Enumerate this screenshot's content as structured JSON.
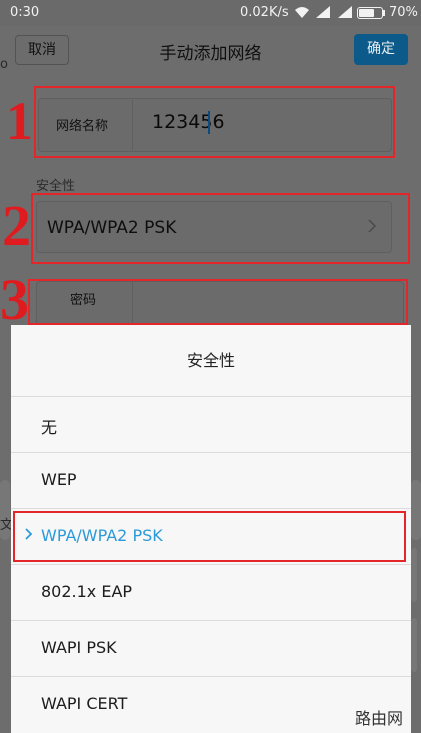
{
  "status_bar": {
    "time": "0:30",
    "speed": "0.02K/s",
    "battery": "70%",
    "battery_level": 0.7
  },
  "header": {
    "cancel": "取消",
    "title": "手动添加网络",
    "confirm": "确定"
  },
  "form": {
    "name_label": "网络名称",
    "name_value": "123456",
    "security_heading": "安全性",
    "security_value": "WPA/WPA2 PSK",
    "password_label": "密码"
  },
  "annotations": [
    "1",
    "2",
    "3"
  ],
  "sheet": {
    "title": "安全性",
    "options": [
      "无",
      "WEP",
      "WPA/WPA2 PSK",
      "802.1x EAP",
      "WAPI PSK",
      "WAPI CERT"
    ],
    "selected_index": 2
  },
  "background_fragments": [
    "o",
    "文"
  ],
  "watermark": "路由网",
  "colors": {
    "accent": "#2b9ad9",
    "annotation_red": "#e2262a",
    "confirm_button": "#0b5a8a"
  }
}
